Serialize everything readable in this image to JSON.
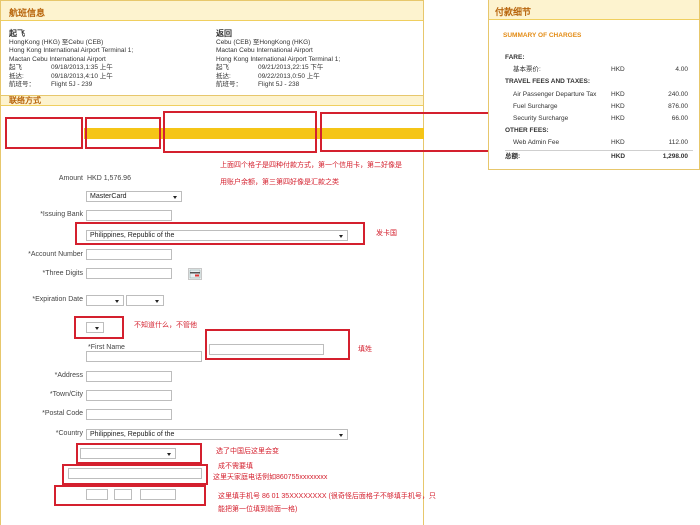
{
  "flight_panel": {
    "title": "航班信息",
    "outbound": {
      "heading": "起飞",
      "route": "HongKong (HKG) 至Cebu (CEB)",
      "from_airport": "Hong Kong International Airport Terminal 1;",
      "to_airport": "Mactan Cebu International Airport",
      "depart_label": "起飞",
      "depart_value": "09/18/2013,1:35 上午",
      "arrive_label": "抵达:",
      "arrive_value": "09/18/2013,4:10 上午",
      "flight_label": "航班号：",
      "flight_value": "Flight 5J - 239"
    },
    "return": {
      "heading": "返回",
      "route": "Cebu (CEB) 至HongKong (HKG)",
      "from_airport": "Mactan Cebu International Airport",
      "to_airport": "Hong Kong International Airport Terminal 1;",
      "depart_label": "起飞",
      "depart_value": "09/21/2013,22:15 下午",
      "arrive_label": "抵达:",
      "arrive_value": "09/22/2013,0:50 上午",
      "flight_label": "航班号：",
      "flight_value": "Flight 5J - 238"
    }
  },
  "payment_panel": {
    "title": "联络方式",
    "amount_label": "Amount",
    "amount_value": "HKD 1,576.96",
    "card_type": "MasterCard",
    "issuing_bank_label": "*Issuing Bank",
    "issuing_bank_value": "",
    "card_country": "Philippines, Republic of the",
    "account_number_label": "*Account Number",
    "three_digits_label": "*Three Digits",
    "expiration_label": "*Expiration Date",
    "first_name_label": "*First Name",
    "address_label": "*Address",
    "town_label": "*Town/City",
    "postal_label": "*Postal Code",
    "country_label": "*Country",
    "country_value": "Philippines, Republic of the"
  },
  "annotations": {
    "tabs_note_line1": "上面四个格子是四种付款方式，第一个信用卡，第二好像是",
    "tabs_note_line2": "用账户余额，第三第四好像是汇款之类",
    "issuer_country_note": "发卡国",
    "unknown_note": "不知道什么，不管他",
    "name_note": "填姓",
    "province_note": "选了中国后这里会变",
    "skip_note": "成不需要填",
    "home_phone_note": "这里天家庭电话例如860755xxxxxxxx",
    "mobile_note_line1": "这里填手机号  86 01  35XXXXXXXX   (很奇怪后面格子不够填手机号，只",
    "mobile_note_line2": "能把第一位填到前面一格)"
  },
  "charges_panel": {
    "title": "付款细节",
    "summary": "SUMMARY OF CHARGES",
    "fare_label": "FARE:",
    "base_fare_label": "基本票价:",
    "base_fare_cur": "HKD",
    "base_fare_amt": "4.00",
    "taxes_label": "TRAVEL FEES AND TAXES:",
    "tax_1_label": "Air Passenger Departure Tax",
    "tax_1_cur": "HKD",
    "tax_1_amt": "240.00",
    "tax_2_label": "Fuel Surcharge",
    "tax_2_cur": "HKD",
    "tax_2_amt": "876.00",
    "tax_3_label": "Security Surcharge",
    "tax_3_cur": "HKD",
    "tax_3_amt": "66.00",
    "other_label": "OTHER FEES:",
    "other_1_label": "Web Admin Fee",
    "other_1_cur": "HKD",
    "other_1_amt": "112.00",
    "total_label": "总额:",
    "total_cur": "HKD",
    "total_amt": "1,298.00"
  },
  "colors": {
    "accent_yellow": "#f5c516",
    "header_bg": "#fdf3cf",
    "header_text": "#b8650c",
    "annotation_red": "#d4202e"
  }
}
